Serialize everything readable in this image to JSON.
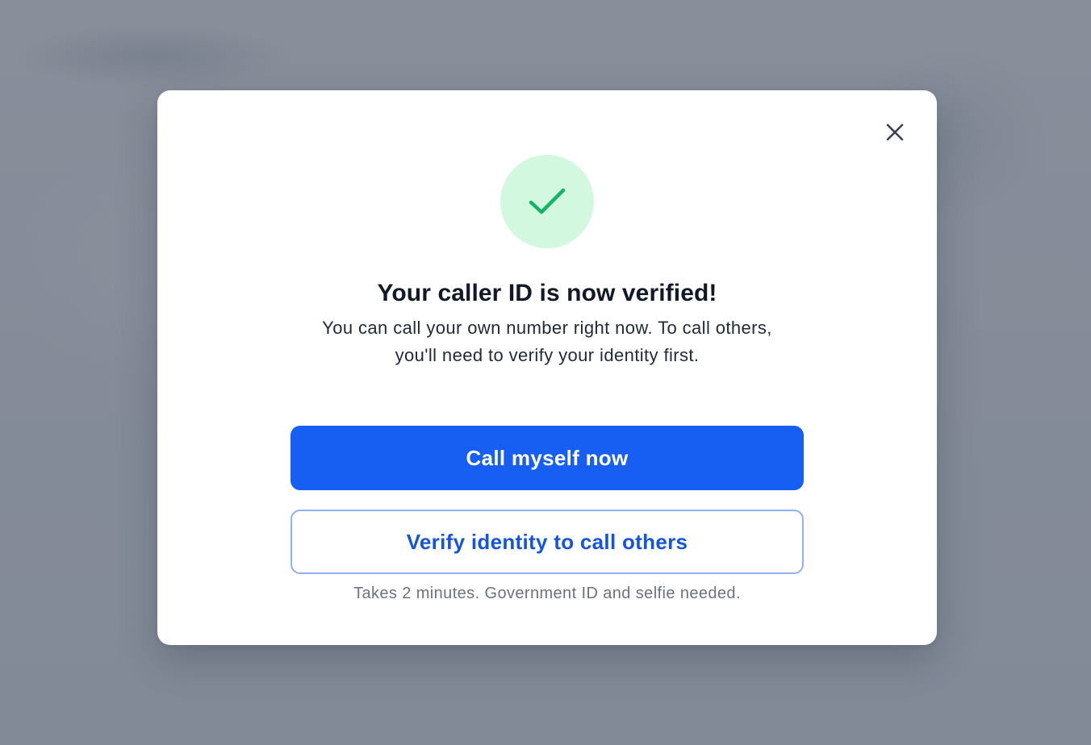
{
  "dialog": {
    "close_icon": "close-icon",
    "status_icon": "checkmark-icon",
    "colors": {
      "success_bg": "#d3f8e0",
      "success_check": "#16b364",
      "primary": "#175ff2",
      "secondary_border": "#8fb0f6",
      "secondary_text": "#1554e0",
      "overlay": "#858c99"
    },
    "title": "Your caller ID is now verified!",
    "subtitle": "You can call your own number right now. To call others, you'll need to verify your identity first.",
    "primary_button_label": "Call myself now",
    "secondary_button_label": "Verify identity to call others",
    "hint": "Takes 2 minutes. Government ID and selfie needed."
  }
}
